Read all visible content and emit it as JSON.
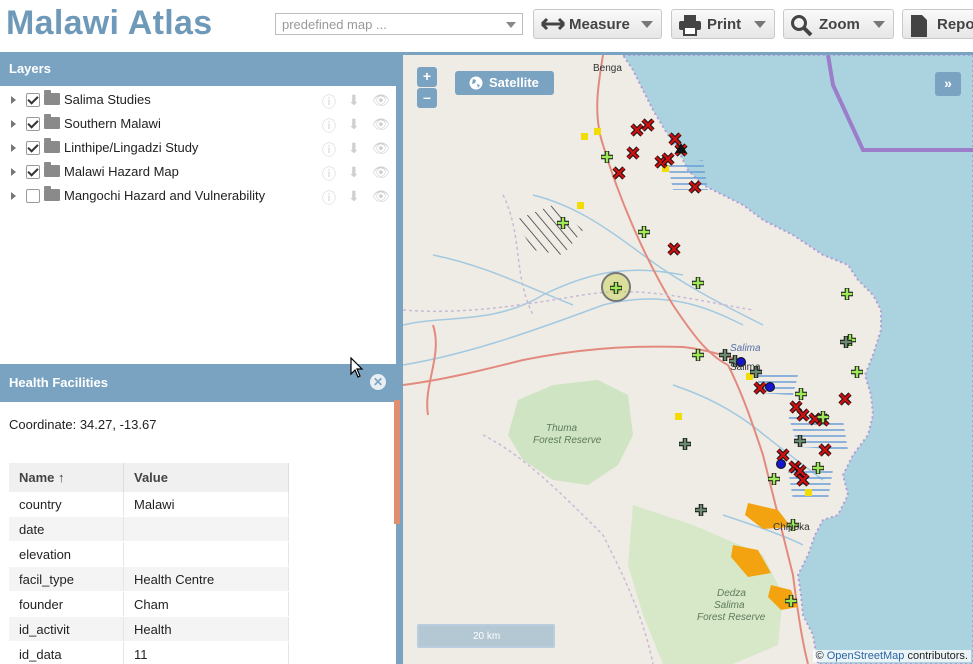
{
  "app": {
    "title": "Malawi Atlas"
  },
  "toolbar": {
    "predefined_placeholder": "predefined map ...",
    "measure_label": "Measure",
    "print_label": "Print",
    "zoom_label": "Zoom",
    "report_label": "Repo"
  },
  "layers_panel": {
    "title": "Layers",
    "items": [
      {
        "label": "Salima Studies",
        "checked": true
      },
      {
        "label": "Southern Malawi",
        "checked": true
      },
      {
        "label": "Linthipe/Lingadzi Study",
        "checked": true
      },
      {
        "label": "Malawi Hazard Map",
        "checked": true
      },
      {
        "label": "Mangochi Hazard and Vulnerability",
        "checked": false
      }
    ]
  },
  "health_panel": {
    "title": "Health Facilities",
    "coordinate": "Coordinate: 34.27, -13.67",
    "columns": [
      "Name ↑",
      "Value"
    ],
    "rows": [
      [
        "country",
        "Malawi"
      ],
      [
        "date",
        ""
      ],
      [
        "elevation",
        ""
      ],
      [
        "facil_type",
        "Health Centre"
      ],
      [
        "founder",
        "Cham"
      ],
      [
        "id_activit",
        "Health"
      ],
      [
        "id_data",
        "11"
      ]
    ]
  },
  "map": {
    "zoom_in": "+",
    "zoom_out": "–",
    "satellite_label": "Satellite",
    "expand_label": "»",
    "scale_label": "20 km",
    "attribution_prefix": "© ",
    "attribution_link": "OpenStreetMap",
    "attribution_suffix": " contributors.",
    "place_labels": {
      "benga": "Benga",
      "salima_blue": "Salima",
      "salima": "Salima",
      "thuma_1": "Thuma",
      "thuma_2": "Forest Reserve",
      "chipoka": "Chipoka",
      "dedza_1": "Dedza",
      "dedza_2": "Salima",
      "dedza_3": "Forest Reserve"
    },
    "colors": {
      "lake": "#aad3df",
      "panel_blue": "#7aa3c2",
      "marker_red": "#cc0000",
      "marker_green": "#8fe04a",
      "hazard_orange": "#f2a30f"
    }
  }
}
